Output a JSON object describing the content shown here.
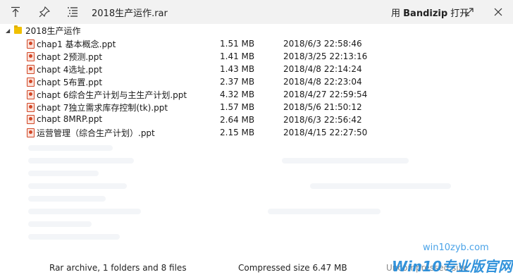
{
  "toolbar": {
    "title": "2018生产运作.rar",
    "open_prefix": "用 ",
    "open_app": "Bandizip",
    "open_suffix": " 打开",
    "icons": [
      "up-arrow-icon",
      "pin-icon",
      "list-icon",
      "expand-icon",
      "close-icon"
    ]
  },
  "tree": {
    "root_label": "2018生产运作",
    "files": [
      {
        "name": "chap1 基本概念.ppt",
        "size": "1.51 MB",
        "date": "2018/6/3 22:58:46"
      },
      {
        "name": "chapt 2预测.ppt",
        "size": "1.41 MB",
        "date": "2018/3/25 22:13:16"
      },
      {
        "name": "chapt 4选址.ppt",
        "size": "1.43 MB",
        "date": "2018/4/8 22:14:24"
      },
      {
        "name": "chapt 5布置.ppt",
        "size": "2.37 MB",
        "date": "2018/4/8 22:23:04"
      },
      {
        "name": "chapt 6综合生产计划与主生产计划.ppt",
        "size": "4.32 MB",
        "date": "2018/4/27 22:59:54"
      },
      {
        "name": "chapt 7独立需求库存控制(tk).ppt",
        "size": "1.57 MB",
        "date": "2018/5/6 21:50:12"
      },
      {
        "name": "chapt 8MRP.ppt",
        "size": "2.64 MB",
        "date": "2018/6/3 22:56:42"
      },
      {
        "name": "运营管理（综合生产计划）.ppt",
        "size": "2.15 MB",
        "date": "2018/4/15 22:27:50"
      }
    ]
  },
  "status": {
    "summary": "Rar archive, 1 folders and 8 files",
    "compressed": "Compressed size 6.47 MB",
    "uncompressed": "Uncompressed size"
  },
  "watermark": {
    "url": "win10zyb.com",
    "text": "Win10专业版官网"
  }
}
